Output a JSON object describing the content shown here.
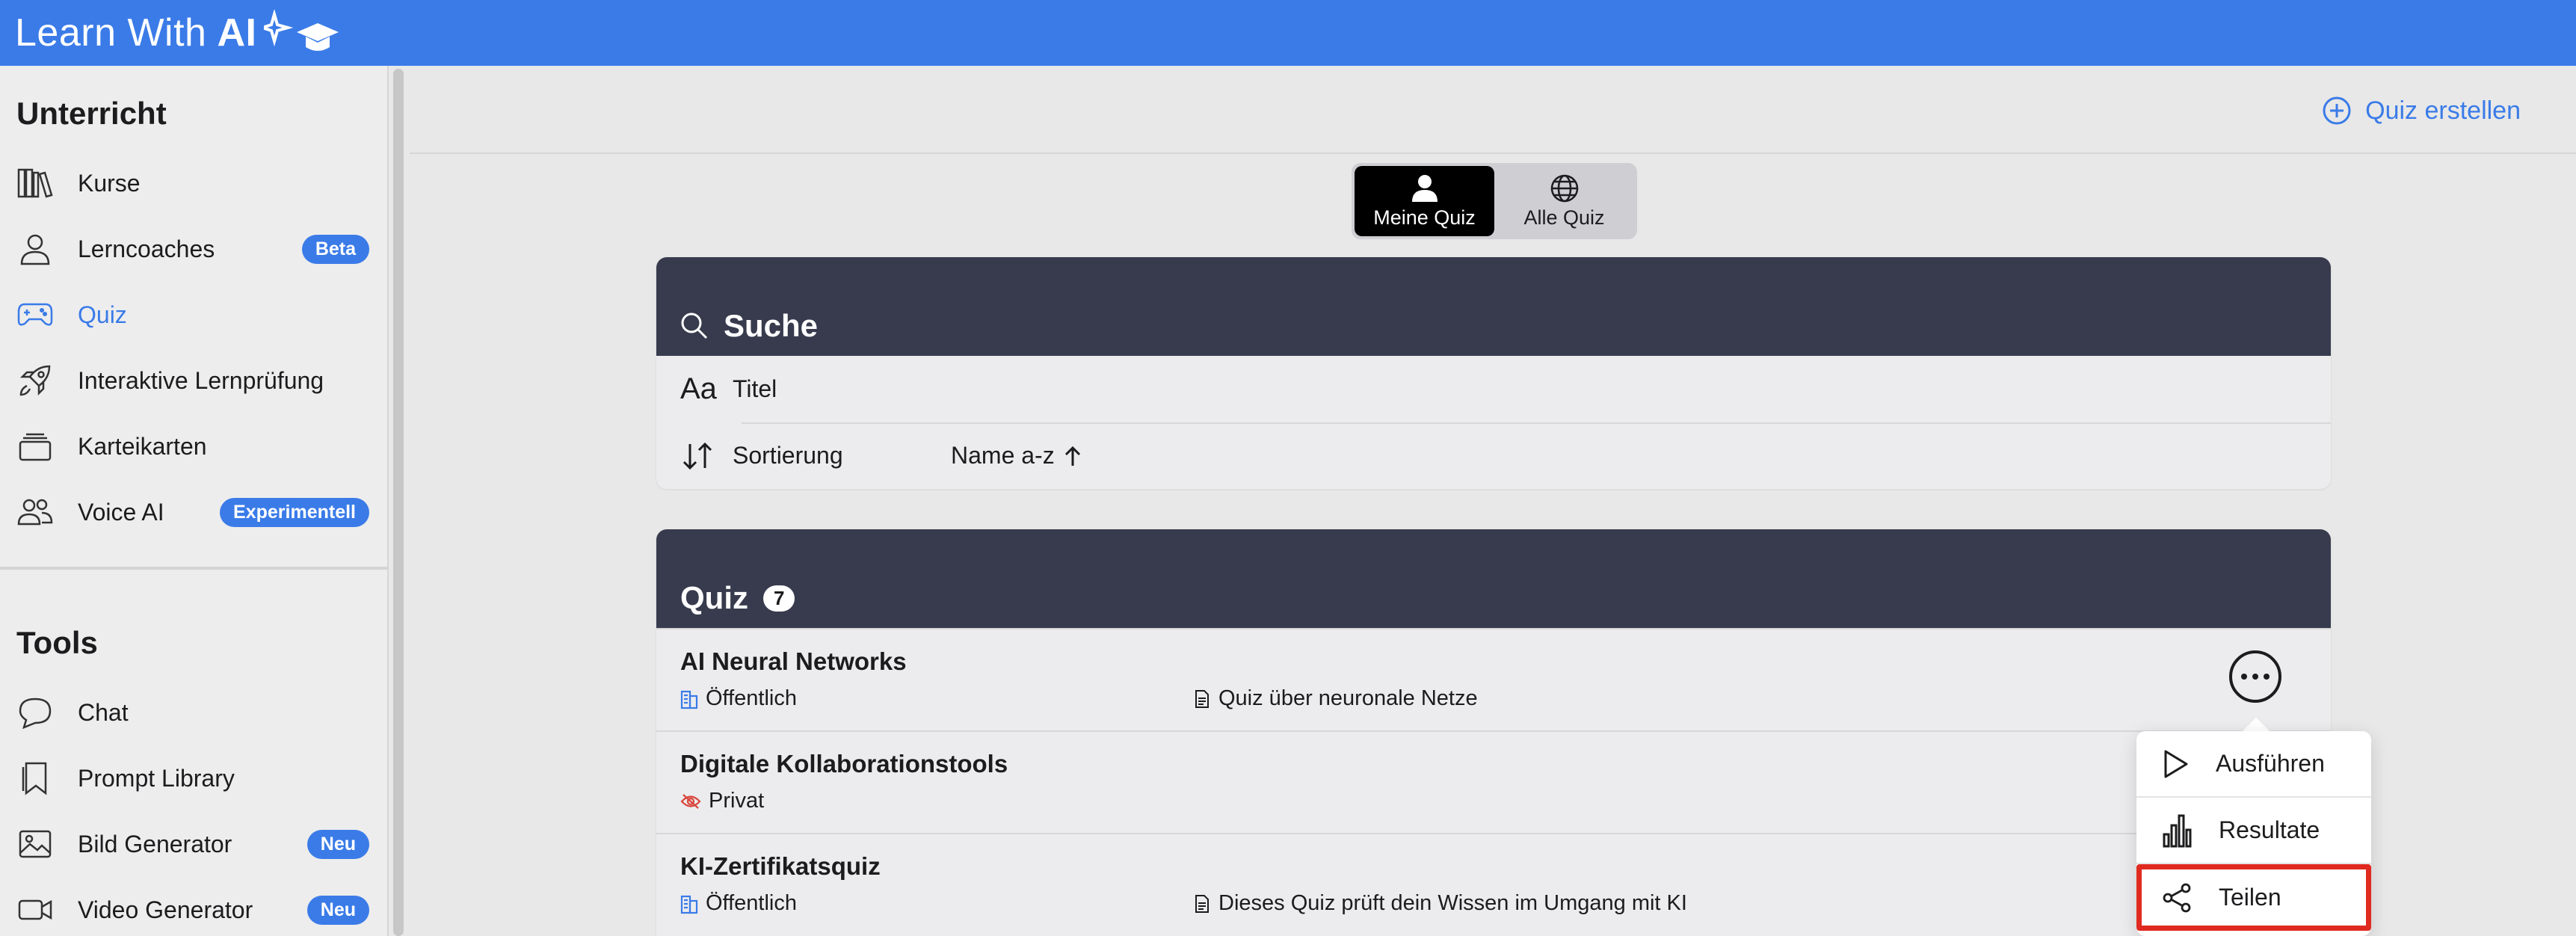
{
  "app": {
    "brand_light": "Learn With",
    "brand_bold": "AI"
  },
  "sidebar": {
    "section1_title": "Unterricht",
    "section1_items": [
      {
        "label": "Kurse",
        "icon": "books-icon"
      },
      {
        "label": "Lerncoaches",
        "icon": "person-icon",
        "badge": "Beta"
      },
      {
        "label": "Quiz",
        "icon": "gamepad-icon",
        "active": true
      },
      {
        "label": "Interaktive Lernprüfung",
        "icon": "rocket-icon"
      },
      {
        "label": "Karteikarten",
        "icon": "cards-icon"
      },
      {
        "label": "Voice AI",
        "icon": "people-icon",
        "badge": "Experimentell"
      }
    ],
    "section2_title": "Tools",
    "section2_items": [
      {
        "label": "Chat",
        "icon": "chat-bubble-icon"
      },
      {
        "label": "Prompt Library",
        "icon": "bookmark-icon"
      },
      {
        "label": "Bild Generator",
        "icon": "image-icon",
        "badge": "Neu"
      },
      {
        "label": "Video Generator",
        "icon": "video-icon",
        "badge": "Neu"
      }
    ]
  },
  "header": {
    "create_label": "Quiz erstellen"
  },
  "segment": {
    "mine": "Meine Quiz",
    "all": "Alle Quiz"
  },
  "search": {
    "title": "Suche",
    "title_field_label": "Titel",
    "sort_label": "Sortierung",
    "sort_value": "Name a-z"
  },
  "quiz_list": {
    "title": "Quiz",
    "count": "7",
    "items": [
      {
        "name": "AI Neural Networks",
        "visibility": "Öffentlich",
        "description": "Quiz über neuronale Netze"
      },
      {
        "name": "Digitale Kollaborationstools",
        "visibility": "Privat",
        "description": ""
      },
      {
        "name": "KI-Zertifikatsquiz",
        "visibility": "Öffentlich",
        "description": "Dieses Quiz prüft dein Wissen im Umgang mit KI"
      }
    ]
  },
  "menu": {
    "run": "Ausführen",
    "results": "Resultate",
    "share": "Teilen"
  },
  "colors": {
    "brand": "#3a7be8",
    "header_dark": "#373b4d",
    "highlight": "#e02a1f",
    "private": "#d9443a"
  }
}
